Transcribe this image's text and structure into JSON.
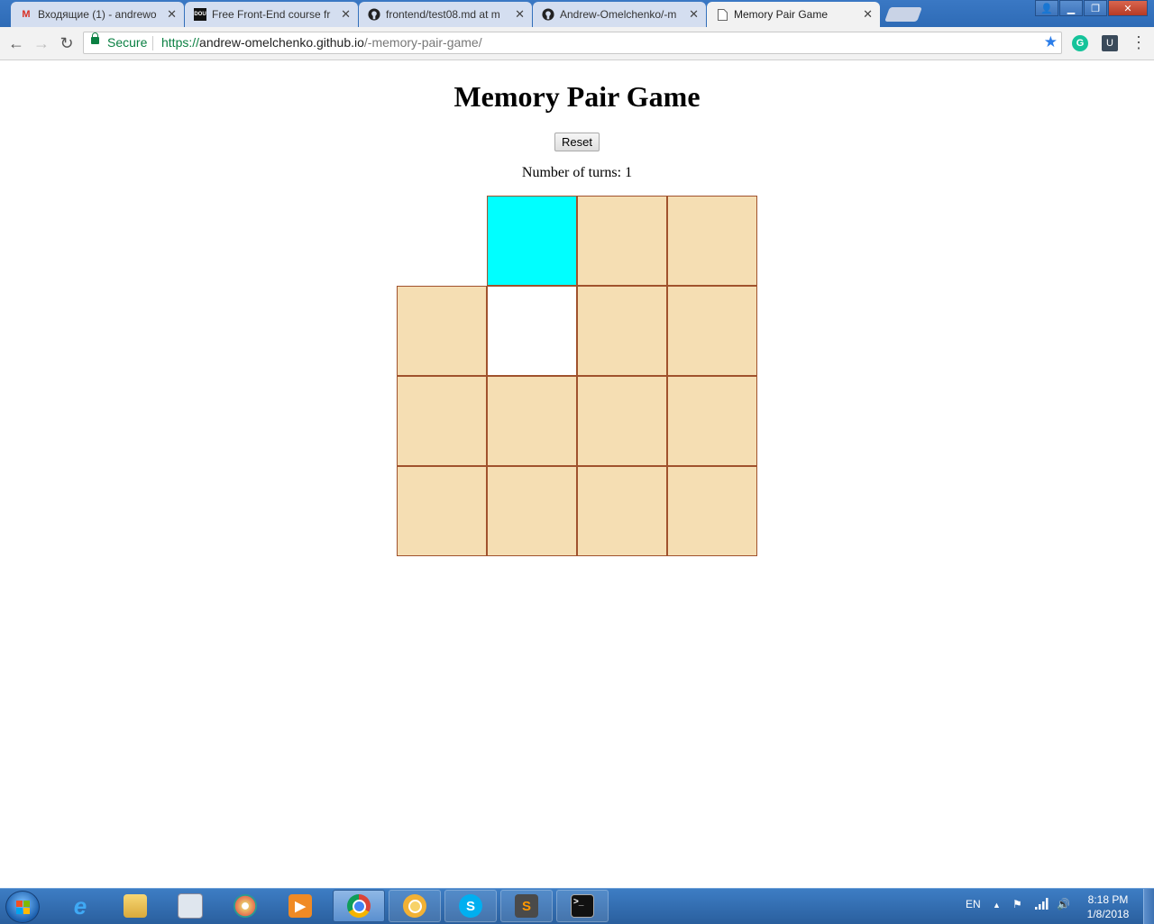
{
  "browser": {
    "tabs": [
      {
        "title": "Входящие (1) - andrewo",
        "icon": "gmail-icon",
        "active": false
      },
      {
        "title": "Free Front-End course fr",
        "icon": "dou-icon",
        "active": false
      },
      {
        "title": "frontend/test08.md at m",
        "icon": "github-icon",
        "active": false
      },
      {
        "title": "Andrew-Omelchenko/-m",
        "icon": "github-icon",
        "active": false
      },
      {
        "title": "Memory Pair Game",
        "icon": "page-icon",
        "active": true
      }
    ],
    "favicon_text": {
      "gmail": "M",
      "dou": "DOU"
    },
    "address": {
      "secure_label": "Secure",
      "url_scheme": "https://",
      "url_host": "andrew-omelchenko.github.io",
      "url_path": "/-memory-pair-game/"
    }
  },
  "page": {
    "title": "Memory Pair Game",
    "reset_label": "Reset",
    "turns_label": "Number of turns: 1",
    "board": {
      "columns": 4,
      "rows": 4,
      "cells": [
        "empty",
        "open",
        "closed",
        "closed",
        "closed",
        "pair",
        "closed",
        "closed",
        "closed",
        "closed",
        "closed",
        "closed",
        "closed",
        "closed",
        "closed",
        "closed"
      ],
      "colors": {
        "closed": "#f5deb3",
        "open": "#00ffff",
        "border": "#a0522d"
      }
    }
  },
  "taskbar": {
    "language": "EN",
    "time": "8:18 PM",
    "date": "1/8/2018",
    "apps": [
      "internet-explorer-icon",
      "file-explorer-icon",
      "calculator-icon",
      "paint-icon",
      "media-player-icon",
      "chrome-icon",
      "chrome-canary-icon",
      "skype-icon",
      "sublime-text-icon",
      "terminal-icon"
    ]
  }
}
